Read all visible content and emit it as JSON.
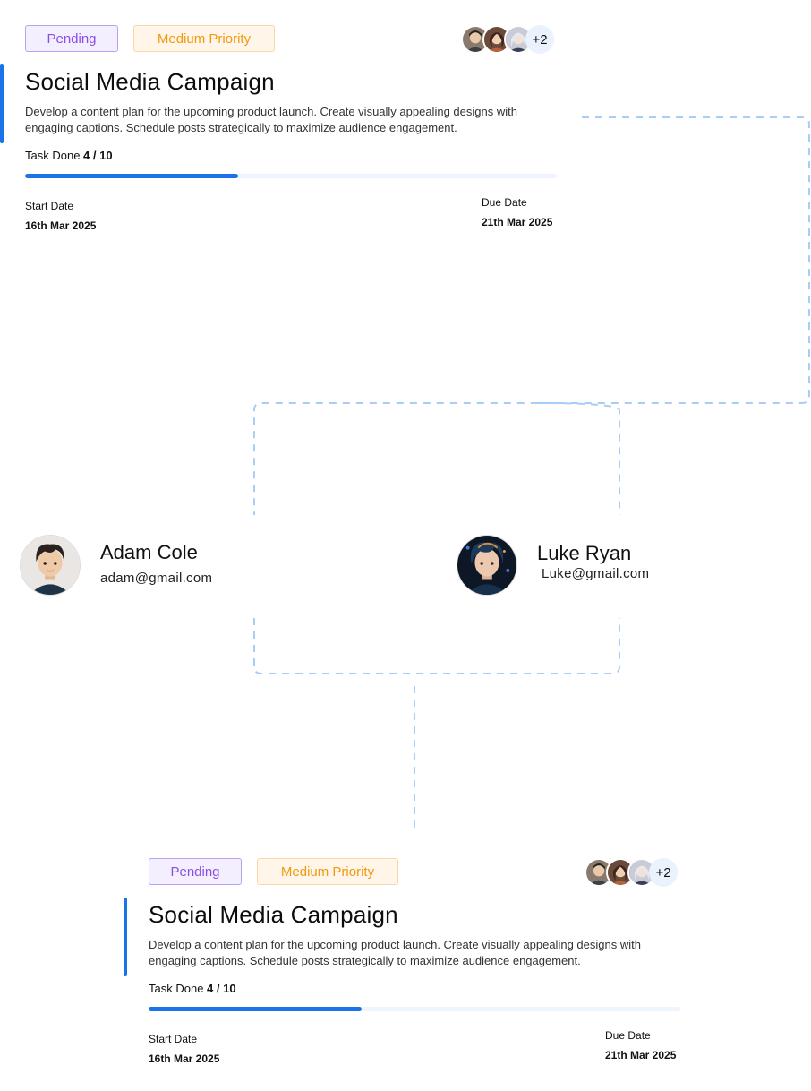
{
  "task_card_top": {
    "status_badge": "Pending",
    "priority_badge": "Medium Priority",
    "extra_members": "+2",
    "title": "Social Media Campaign",
    "description": "Develop a content plan for the upcoming product launch. Create visually appealing designs with engaging captions. Schedule posts strategically to maximize audience engagement.",
    "task_done_label": "Task Done",
    "task_done_value": "4 / 10",
    "progress_fraction": 0.4,
    "start_date_label": "Start Date",
    "start_date": "16th Mar 2025",
    "due_date_label": "Due Date",
    "due_date": "21th Mar 2025"
  },
  "people": [
    {
      "name": "Adam Cole",
      "email": "adam@gmail.com"
    },
    {
      "name": "Luke Ryan",
      "email": "Luke@gmail.com"
    }
  ],
  "task_card_bottom": {
    "status_badge": "Pending",
    "priority_badge": "Medium Priority",
    "extra_members": "+2",
    "title": "Social Media Campaign",
    "description": "Develop a content plan for the upcoming product launch. Create visually appealing designs with engaging captions. Schedule posts strategically to maximize audience engagement.",
    "task_done_label": "Task Done",
    "task_done_value": "4 / 10",
    "progress_fraction": 0.4,
    "start_date_label": "Start Date",
    "start_date": "16th Mar 2025",
    "due_date_label": "Due Date",
    "due_date": "21th Mar 2025"
  },
  "colors": {
    "accent": "#1a73e8",
    "pending": "#8a4ee6",
    "priority": "#f29a0f",
    "connector": "#a8cdf7"
  },
  "icons": [
    "member-avatar-icon",
    "user-avatar-icon"
  ]
}
